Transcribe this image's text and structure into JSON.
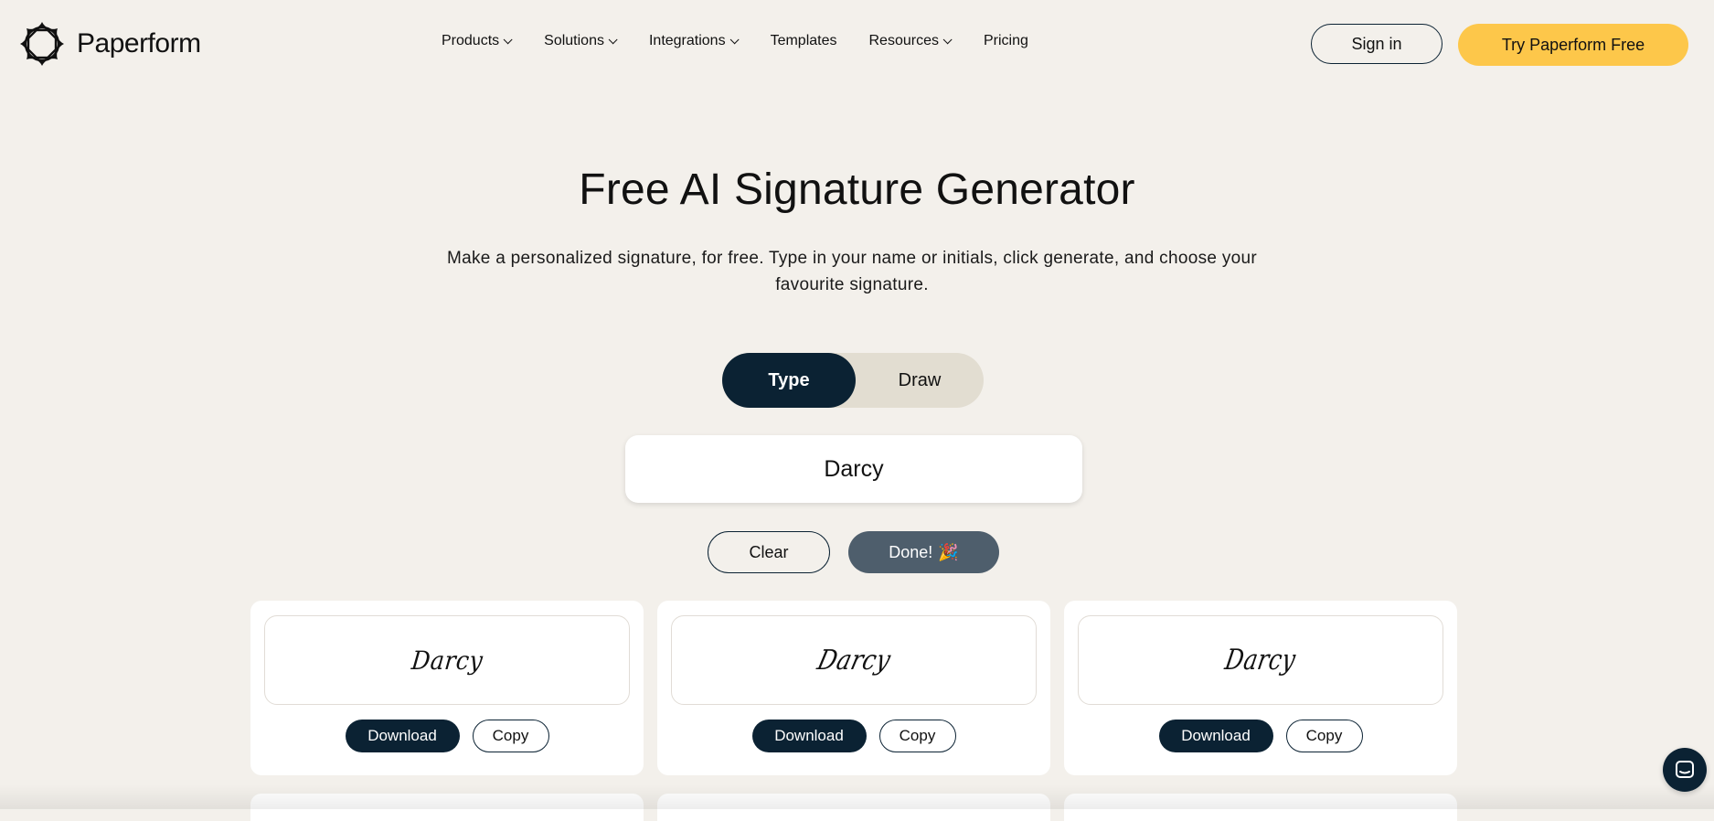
{
  "header": {
    "logo_text": "Paperform",
    "nav": {
      "products": "Products",
      "solutions": "Solutions",
      "integrations": "Integrations",
      "templates": "Templates",
      "resources": "Resources",
      "pricing": "Pricing"
    },
    "sign_in": "Sign in",
    "try_free": "Try Paperform Free"
  },
  "hero": {
    "title": "Free AI Signature Generator",
    "subtitle": "Make a personalized signature, for free. Type in your name or initials, click generate, and choose your favourite signature."
  },
  "mode_toggle": {
    "type": "Type",
    "draw": "Draw",
    "selected": "Type"
  },
  "name_input": {
    "value": "Darcy"
  },
  "actions": {
    "clear": "Clear",
    "done": "Done!",
    "done_emoji": "🎉"
  },
  "signatures": [
    {
      "text": "Darcy",
      "download": "Download",
      "copy": "Copy"
    },
    {
      "text": "Darcy",
      "download": "Download",
      "copy": "Copy"
    },
    {
      "text": "Darcy",
      "download": "Download",
      "copy": "Copy"
    }
  ],
  "colors": {
    "background": "#f3f0eb",
    "primary_dark": "#0b2233",
    "accent_yellow": "#fdc74a",
    "toggle_track": "#e2ddd1",
    "done_button": "#4e5e6c"
  }
}
